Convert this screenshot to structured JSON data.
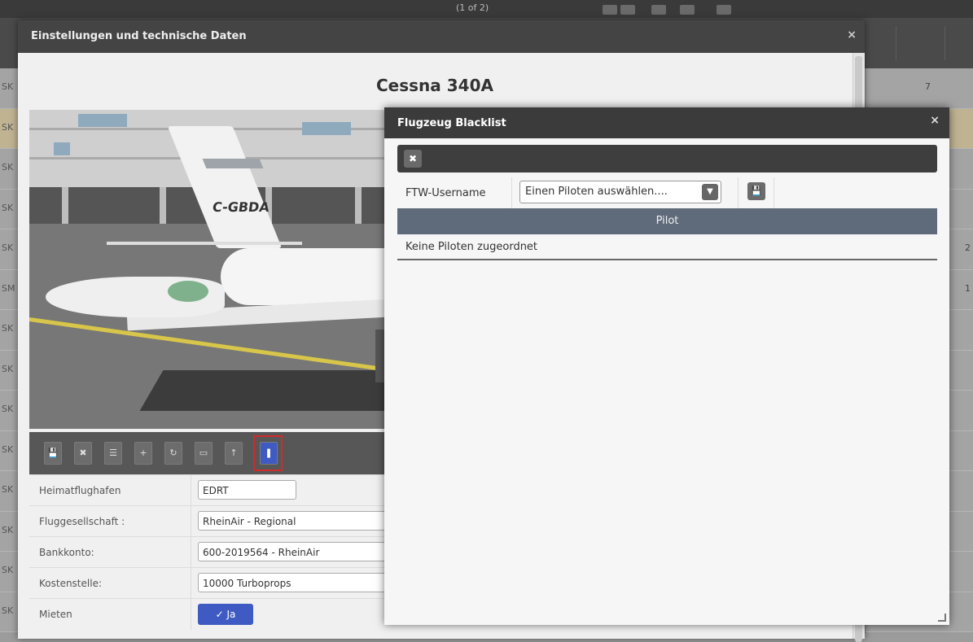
{
  "background": {
    "pager_text": "(1 of 2)",
    "left_fragments": [
      "SK",
      "SK",
      "SK",
      "SK",
      "SK",
      "SM",
      "SK",
      "SK",
      "SK",
      "SK",
      "SK",
      "SK",
      "SK",
      "SK"
    ],
    "right_values": [
      "7",
      "2",
      "1"
    ]
  },
  "main_modal": {
    "title": "Einstellungen und technische Daten",
    "close_icon": "×",
    "aircraft_name": "Cessna 340A",
    "photo": {
      "registration": "C-GBDA"
    },
    "toolbar": {
      "save": "💾",
      "delete": "✖",
      "list": "☰",
      "add": "+",
      "refresh": "↻",
      "screen": "▭",
      "upload": "↑",
      "blacklist": "❚"
    },
    "form": {
      "home_airport_label": "Heimatflughafen",
      "home_airport_value": "EDRT",
      "airline_label": "Fluggesellschaft :",
      "airline_value": "RheinAir - Regional",
      "bank_label": "Bankkonto:",
      "bank_value": "600-2019564 - RheinAir",
      "cost_center_label": "Kostenstelle:",
      "cost_center_value": "10000 Turboprops",
      "rent_label": "Mieten",
      "rent_button": "✓ Ja"
    }
  },
  "blacklist_modal": {
    "title": "Flugzeug Blacklist",
    "close_icon": "×",
    "bar_button": "✖",
    "username_label": "FTW-Username",
    "pilot_select_value": "Einen Piloten auswählen....",
    "save_icon": "💾",
    "column_header": "Pilot",
    "empty_row": "Keine Piloten zugeordnet"
  }
}
